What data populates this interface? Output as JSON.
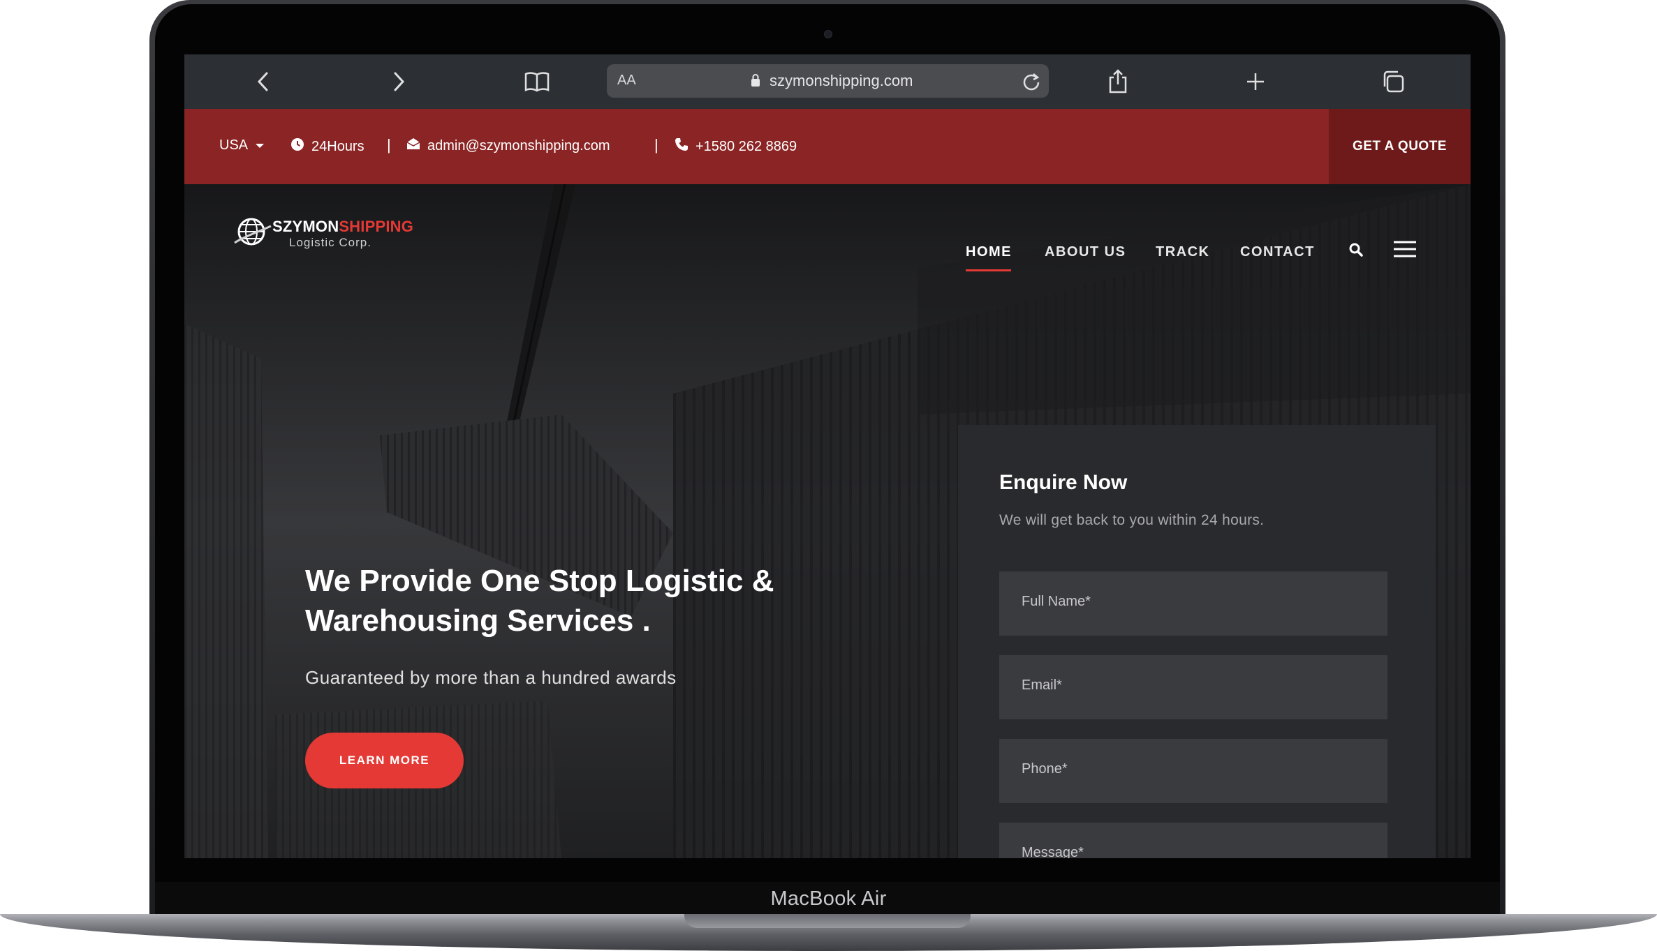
{
  "device": {
    "label": "MacBook Air"
  },
  "browser": {
    "url_aa": "AA",
    "url": "szymonshipping.com",
    "icons": [
      "chevron-left-icon",
      "chevron-right-icon",
      "book-icon",
      "lock-icon",
      "reload-icon",
      "share-icon",
      "plus-icon",
      "tabs-icon"
    ]
  },
  "topbar": {
    "country": "USA",
    "hours": "24Hours",
    "email": "admin@szymonshipping.com",
    "phone": "+1580 262 8869",
    "separator": "|",
    "quote_label": "GET A QUOTE",
    "colors": {
      "bar": "#8b2424",
      "quote_bg": "#6e1a1a"
    }
  },
  "brand": {
    "name_white": "SZYMON",
    "name_red": "SHIPPING",
    "tagline": "Logistic Corp.",
    "accent": "#e53935"
  },
  "nav": {
    "items": [
      {
        "label": "HOME",
        "active": true
      },
      {
        "label": "ABOUT US",
        "active": false
      },
      {
        "label": "TRACK",
        "active": false
      },
      {
        "label": "CONTACT",
        "active": false
      }
    ]
  },
  "hero": {
    "title_line1": "We Provide One Stop Logistic &",
    "title_line2": "Warehousing Services .",
    "subtitle": "Guaranteed by more than a hundred awards",
    "cta_label": "LEARN MORE"
  },
  "enquire": {
    "title": "Enquire Now",
    "subtitle": "We will get back to you within 24 hours.",
    "fields": {
      "name": "Full Name*",
      "email": "Email*",
      "phone": "Phone*",
      "message": "Message*"
    }
  }
}
